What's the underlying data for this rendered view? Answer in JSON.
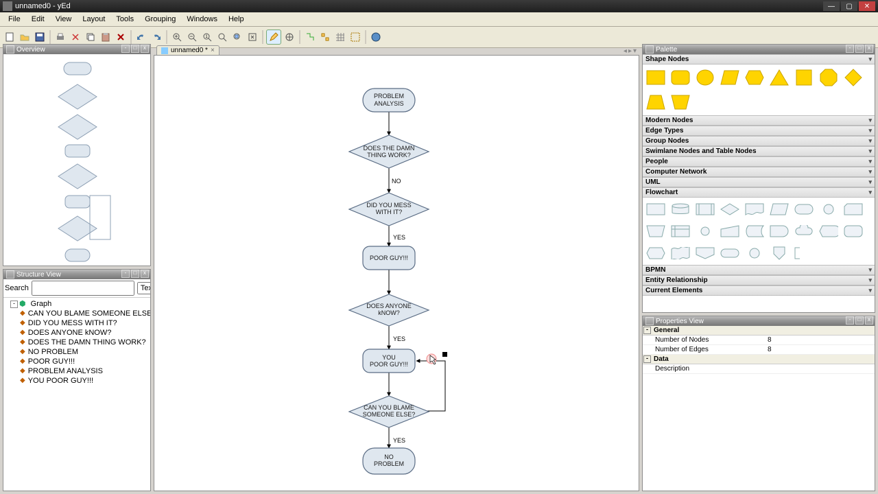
{
  "window": {
    "title": "unnamed0 - yEd"
  },
  "menus": [
    "File",
    "Edit",
    "View",
    "Layout",
    "Tools",
    "Grouping",
    "Windows",
    "Help"
  ],
  "panels": {
    "overview": "Overview",
    "structure": "Structure View",
    "palette": "Palette",
    "properties": "Properties View"
  },
  "tabs": {
    "active": "unnamed0 *"
  },
  "structure": {
    "search_label": "Search",
    "combo": "Text",
    "root": "Graph",
    "items": [
      "CAN YOU BLAME SOMEONE ELSE?",
      "DID YOU MESS WITH IT?",
      "DOES ANYONE kNOW?",
      "DOES THE DAMN THING WORK?",
      "NO PROBLEM",
      "POOR GUY!!!",
      "PROBLEM ANALYSIS",
      "YOU POOR GUY!!!"
    ]
  },
  "palette": {
    "categories": [
      "Shape Nodes",
      "Modern Nodes",
      "Edge Types",
      "Group Nodes",
      "Swimlane Nodes and Table Nodes",
      "People",
      "Computer Network",
      "UML",
      "Flowchart",
      "BPMN",
      "Entity Relationship",
      "Current Elements"
    ]
  },
  "properties": {
    "general": "General",
    "nodes_k": "Number of Nodes",
    "nodes_v": "8",
    "edges_k": "Number of Edges",
    "edges_v": "8",
    "data": "Data",
    "desc_k": "Description",
    "desc_v": ""
  },
  "flow": {
    "n0": "PROBLEM\nANALYSIS",
    "n1": "DOES THE DAMN\nTHING WORK?",
    "n2": "DID YOU MESS\nWITH IT?",
    "n3": "POOR GUY!!!",
    "n4": "DOES ANYONE\nkNOW?",
    "n5": "YOU\nPOOR GUY!!!",
    "n6": "CAN YOU BLAME\nSOMEONE ELSE?",
    "n7": "NO\nPROBLEM",
    "e_no": "NO",
    "e_yes1": "YES",
    "e_yes2": "YES",
    "e_yes3": "YES"
  },
  "chart_data": {
    "type": "flowchart",
    "nodes": [
      {
        "id": "n0",
        "shape": "terminator",
        "label": "PROBLEM ANALYSIS"
      },
      {
        "id": "n1",
        "shape": "decision",
        "label": "DOES THE DAMN THING WORK?"
      },
      {
        "id": "n2",
        "shape": "decision",
        "label": "DID YOU MESS WITH IT?"
      },
      {
        "id": "n3",
        "shape": "terminator",
        "label": "POOR GUY!!!"
      },
      {
        "id": "n4",
        "shape": "decision",
        "label": "DOES ANYONE kNOW?"
      },
      {
        "id": "n5",
        "shape": "terminator",
        "label": "YOU POOR GUY!!!"
      },
      {
        "id": "n6",
        "shape": "decision",
        "label": "CAN YOU BLAME SOMEONE ELSE?"
      },
      {
        "id": "n7",
        "shape": "terminator",
        "label": "NO PROBLEM"
      }
    ],
    "edges": [
      {
        "from": "n0",
        "to": "n1",
        "label": ""
      },
      {
        "from": "n1",
        "to": "n2",
        "label": "NO"
      },
      {
        "from": "n2",
        "to": "n3",
        "label": "YES"
      },
      {
        "from": "n3",
        "to": "n4",
        "label": ""
      },
      {
        "from": "n4",
        "to": "n5",
        "label": "YES"
      },
      {
        "from": "n5",
        "to": "n6",
        "label": ""
      },
      {
        "from": "n6",
        "to": "n7",
        "label": "YES"
      },
      {
        "from": "n6",
        "to": "n5",
        "label": "",
        "routing": "right-loop"
      }
    ]
  }
}
